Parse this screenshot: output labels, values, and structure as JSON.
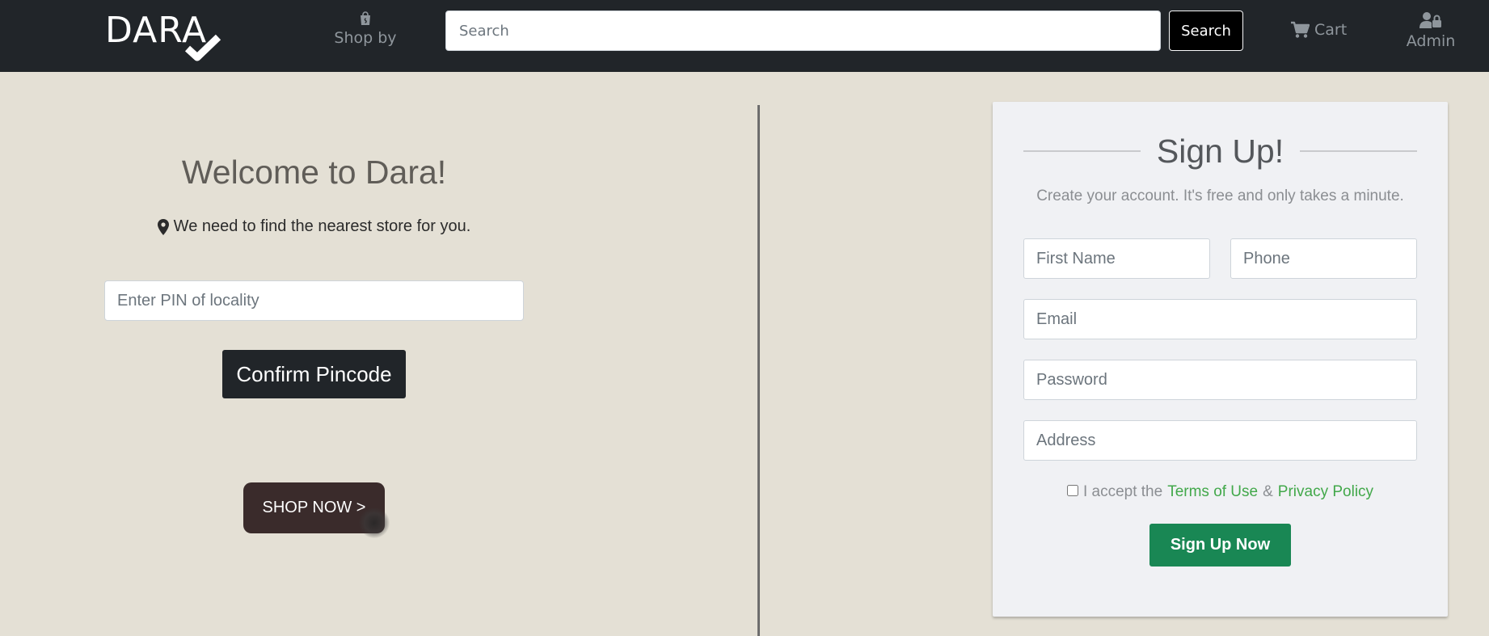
{
  "navbar": {
    "logo_text": "DARA",
    "shop_by_label": "Shop by",
    "search_placeholder": "Search",
    "search_button": "Search",
    "cart_label": "Cart",
    "admin_label": "Admin"
  },
  "left": {
    "welcome_title": "Welcome to Dara!",
    "store_message": "We need to find the nearest store for you.",
    "pin_placeholder": "Enter PIN of locality",
    "confirm_button": "Confirm Pincode",
    "shop_now_button": "SHOP NOW >"
  },
  "signup": {
    "title": "Sign Up!",
    "subtitle": "Create your account. It's free and only takes a minute.",
    "first_name_placeholder": "First Name",
    "phone_placeholder": "Phone",
    "email_placeholder": "Email",
    "password_placeholder": "Password",
    "address_placeholder": "Address",
    "accept_text": "I accept the",
    "terms_link": "Terms of Use",
    "ampersand": "&",
    "privacy_link": "Privacy Policy",
    "submit_button": "Sign Up Now"
  },
  "colors": {
    "navbar_bg": "#212529",
    "page_bg": "#e4e0d5",
    "card_bg": "#f0f1f4",
    "link_green": "#42a84a",
    "submit_green": "#198754",
    "shop_now_bg": "#3a2b2b"
  },
  "icons": {
    "shop_by": "shopping-bag-icon",
    "cart": "cart-icon",
    "admin": "user-lock-icon",
    "location": "map-marker-icon",
    "logo_mark": "checkmark-icon"
  }
}
